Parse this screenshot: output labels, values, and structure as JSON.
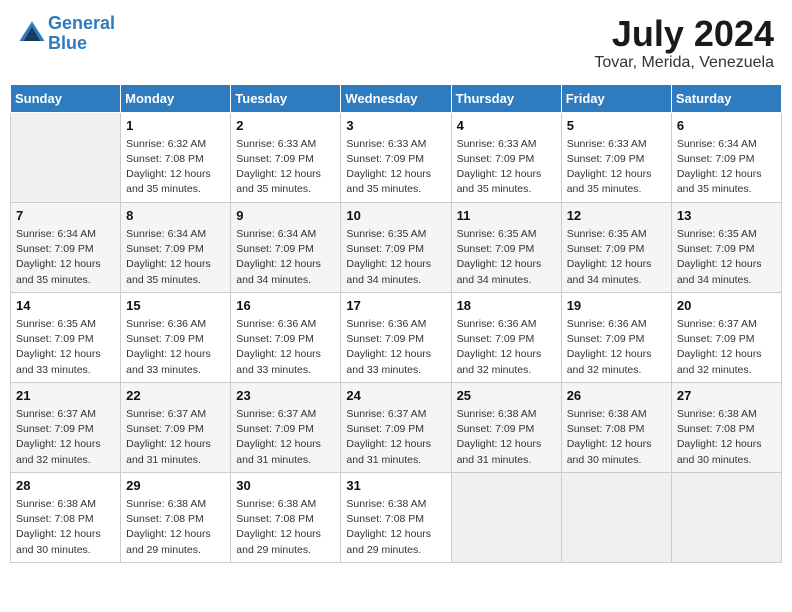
{
  "header": {
    "logo_line1": "General",
    "logo_line2": "Blue",
    "month_title": "July 2024",
    "location": "Tovar, Merida, Venezuela"
  },
  "weekdays": [
    "Sunday",
    "Monday",
    "Tuesday",
    "Wednesday",
    "Thursday",
    "Friday",
    "Saturday"
  ],
  "weeks": [
    [
      {
        "day": "",
        "sunrise": "",
        "sunset": "",
        "daylight": ""
      },
      {
        "day": "1",
        "sunrise": "6:32 AM",
        "sunset": "7:08 PM",
        "daylight": "12 hours and 35 minutes."
      },
      {
        "day": "2",
        "sunrise": "6:33 AM",
        "sunset": "7:09 PM",
        "daylight": "12 hours and 35 minutes."
      },
      {
        "day": "3",
        "sunrise": "6:33 AM",
        "sunset": "7:09 PM",
        "daylight": "12 hours and 35 minutes."
      },
      {
        "day": "4",
        "sunrise": "6:33 AM",
        "sunset": "7:09 PM",
        "daylight": "12 hours and 35 minutes."
      },
      {
        "day": "5",
        "sunrise": "6:33 AM",
        "sunset": "7:09 PM",
        "daylight": "12 hours and 35 minutes."
      },
      {
        "day": "6",
        "sunrise": "6:34 AM",
        "sunset": "7:09 PM",
        "daylight": "12 hours and 35 minutes."
      }
    ],
    [
      {
        "day": "7",
        "sunrise": "6:34 AM",
        "sunset": "7:09 PM",
        "daylight": "12 hours and 35 minutes."
      },
      {
        "day": "8",
        "sunrise": "6:34 AM",
        "sunset": "7:09 PM",
        "daylight": "12 hours and 35 minutes."
      },
      {
        "day": "9",
        "sunrise": "6:34 AM",
        "sunset": "7:09 PM",
        "daylight": "12 hours and 34 minutes."
      },
      {
        "day": "10",
        "sunrise": "6:35 AM",
        "sunset": "7:09 PM",
        "daylight": "12 hours and 34 minutes."
      },
      {
        "day": "11",
        "sunrise": "6:35 AM",
        "sunset": "7:09 PM",
        "daylight": "12 hours and 34 minutes."
      },
      {
        "day": "12",
        "sunrise": "6:35 AM",
        "sunset": "7:09 PM",
        "daylight": "12 hours and 34 minutes."
      },
      {
        "day": "13",
        "sunrise": "6:35 AM",
        "sunset": "7:09 PM",
        "daylight": "12 hours and 34 minutes."
      }
    ],
    [
      {
        "day": "14",
        "sunrise": "6:35 AM",
        "sunset": "7:09 PM",
        "daylight": "12 hours and 33 minutes."
      },
      {
        "day": "15",
        "sunrise": "6:36 AM",
        "sunset": "7:09 PM",
        "daylight": "12 hours and 33 minutes."
      },
      {
        "day": "16",
        "sunrise": "6:36 AM",
        "sunset": "7:09 PM",
        "daylight": "12 hours and 33 minutes."
      },
      {
        "day": "17",
        "sunrise": "6:36 AM",
        "sunset": "7:09 PM",
        "daylight": "12 hours and 33 minutes."
      },
      {
        "day": "18",
        "sunrise": "6:36 AM",
        "sunset": "7:09 PM",
        "daylight": "12 hours and 32 minutes."
      },
      {
        "day": "19",
        "sunrise": "6:36 AM",
        "sunset": "7:09 PM",
        "daylight": "12 hours and 32 minutes."
      },
      {
        "day": "20",
        "sunrise": "6:37 AM",
        "sunset": "7:09 PM",
        "daylight": "12 hours and 32 minutes."
      }
    ],
    [
      {
        "day": "21",
        "sunrise": "6:37 AM",
        "sunset": "7:09 PM",
        "daylight": "12 hours and 32 minutes."
      },
      {
        "day": "22",
        "sunrise": "6:37 AM",
        "sunset": "7:09 PM",
        "daylight": "12 hours and 31 minutes."
      },
      {
        "day": "23",
        "sunrise": "6:37 AM",
        "sunset": "7:09 PM",
        "daylight": "12 hours and 31 minutes."
      },
      {
        "day": "24",
        "sunrise": "6:37 AM",
        "sunset": "7:09 PM",
        "daylight": "12 hours and 31 minutes."
      },
      {
        "day": "25",
        "sunrise": "6:38 AM",
        "sunset": "7:09 PM",
        "daylight": "12 hours and 31 minutes."
      },
      {
        "day": "26",
        "sunrise": "6:38 AM",
        "sunset": "7:08 PM",
        "daylight": "12 hours and 30 minutes."
      },
      {
        "day": "27",
        "sunrise": "6:38 AM",
        "sunset": "7:08 PM",
        "daylight": "12 hours and 30 minutes."
      }
    ],
    [
      {
        "day": "28",
        "sunrise": "6:38 AM",
        "sunset": "7:08 PM",
        "daylight": "12 hours and 30 minutes."
      },
      {
        "day": "29",
        "sunrise": "6:38 AM",
        "sunset": "7:08 PM",
        "daylight": "12 hours and 29 minutes."
      },
      {
        "day": "30",
        "sunrise": "6:38 AM",
        "sunset": "7:08 PM",
        "daylight": "12 hours and 29 minutes."
      },
      {
        "day": "31",
        "sunrise": "6:38 AM",
        "sunset": "7:08 PM",
        "daylight": "12 hours and 29 minutes."
      },
      {
        "day": "",
        "sunrise": "",
        "sunset": "",
        "daylight": ""
      },
      {
        "day": "",
        "sunrise": "",
        "sunset": "",
        "daylight": ""
      },
      {
        "day": "",
        "sunrise": "",
        "sunset": "",
        "daylight": ""
      }
    ]
  ]
}
